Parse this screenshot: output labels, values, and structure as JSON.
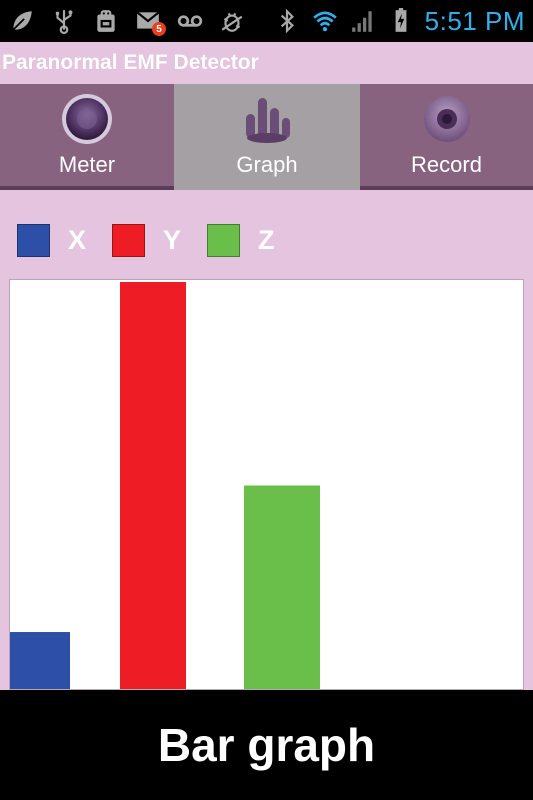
{
  "status_bar": {
    "time": "5:51 PM",
    "notification_count": "5",
    "icons_left": [
      "leaf-icon",
      "usb-icon",
      "android-debug-icon",
      "gmail-icon",
      "voicemail-icon",
      "bug-icon"
    ],
    "icons_right": [
      "bluetooth-icon",
      "wifi-icon",
      "signal-icon",
      "battery-charging-icon"
    ],
    "time_color": "#2fb0ea"
  },
  "app": {
    "title": "Paranormal EMF Detector",
    "background_color": "#e4c4de"
  },
  "tabs": [
    {
      "label": "Meter",
      "icon": "meter-icon",
      "selected": false
    },
    {
      "label": "Graph",
      "icon": "graph-icon",
      "selected": true
    },
    {
      "label": "Record",
      "icon": "record-icon",
      "selected": false
    }
  ],
  "legend": [
    {
      "label": "X",
      "color": "#2e4fa8"
    },
    {
      "label": "Y",
      "color": "#ee1c24"
    },
    {
      "label": "Z",
      "color": "#6abf4b"
    }
  ],
  "chart_data": {
    "type": "bar",
    "categories": [
      "X",
      "Y",
      "Z"
    ],
    "values": [
      14,
      100,
      50
    ],
    "ylim": [
      0,
      100
    ],
    "colors": [
      "#2e4fa8",
      "#ee1c24",
      "#6abf4b"
    ],
    "grid": false,
    "legend_position": "top-left"
  },
  "caption": {
    "text": "Bar graph"
  }
}
